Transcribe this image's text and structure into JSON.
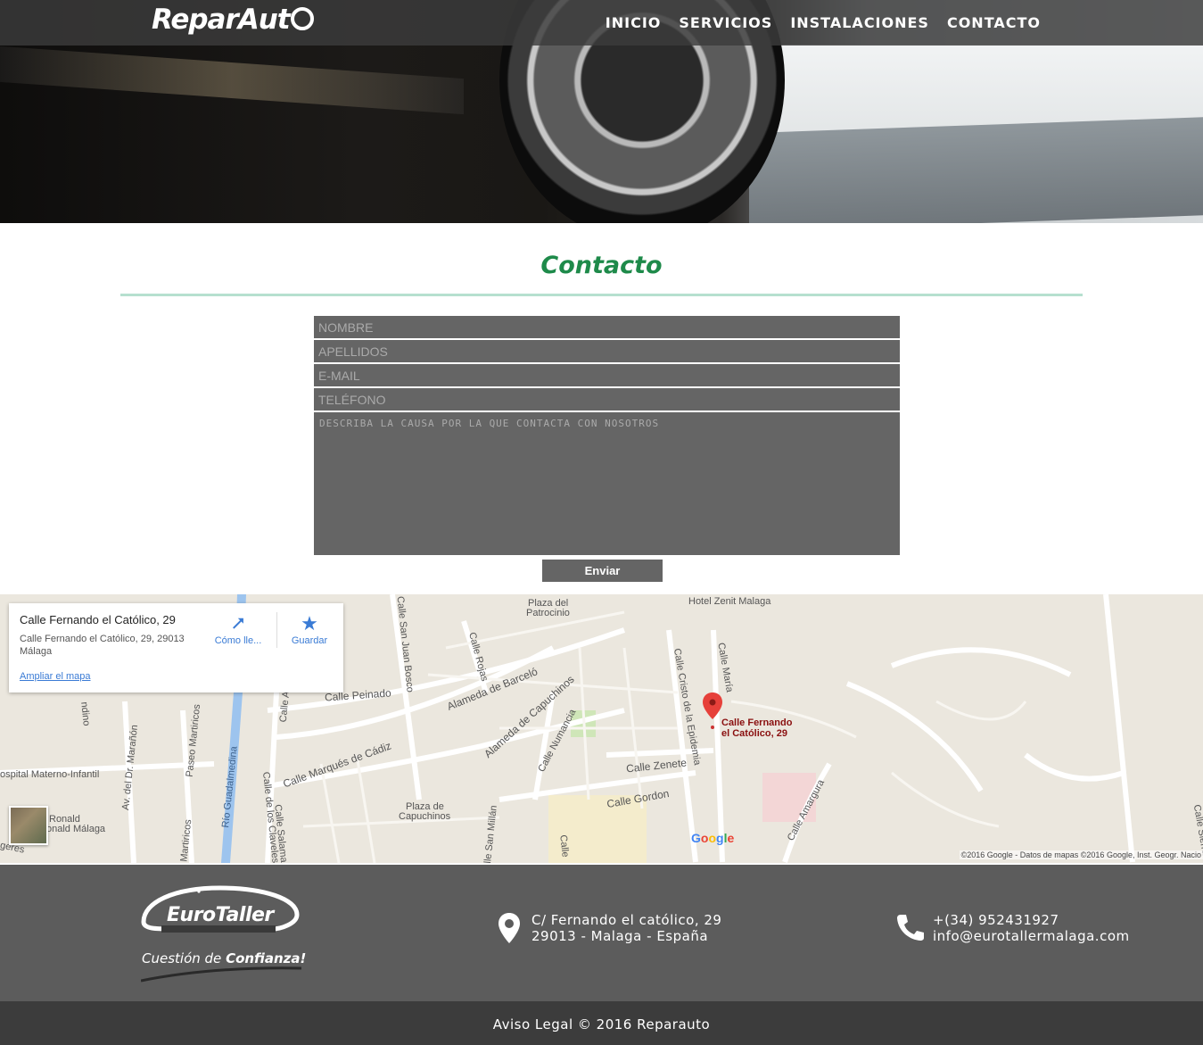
{
  "header": {
    "logo_text": "ReparAut",
    "nav": [
      "INICIO",
      "SERVICIOS",
      "INSTALACIONES",
      "CONTACTO"
    ]
  },
  "contact": {
    "title": "Contacto",
    "fields": {
      "nombre": "NOMBRE",
      "apellidos": "APELLIDOS",
      "email": "E-MAIL",
      "telefono": "TELÉFONO",
      "mensaje": "DESCRIBA LA CAUSA POR LA QUE CONTACTA CON NOSOTROS"
    },
    "submit_label": "Enviar"
  },
  "map": {
    "info_title": "Calle Fernando el Católico, 29",
    "info_address": "Calle Fernando el Católico, 29, 29013 Málaga",
    "enlarge_link": "Ampliar el mapa",
    "directions_label": "Cómo lle...",
    "save_label": "Guardar",
    "pin_label_line1": "Calle Fernando",
    "pin_label_line2": "el Católico, 29",
    "google_logo": "Google",
    "copyright": "©2016 Google - Datos de mapas ©2016 Google, Inst. Geogr. Nacio",
    "labels": {
      "l1": "Plaza del",
      "l2": "Patrocinio",
      "l3": "Hotel Zenit Malaga",
      "l4": "Calle San Juan Bosco",
      "l5": "Calle Rojas",
      "l6": "Alameda de Barceló",
      "l7": "Alameda de Capuchinos",
      "l8": "Calle Peinado",
      "l9": "Calle Cristo de la Epidemia",
      "l10": "Calle María",
      "l11": "Calle Zenete",
      "l12": "Calle Gordon",
      "l13": "Calle Numancia",
      "l14": "Calle Marqués de Cádiz",
      "l15": "Plaza de",
      "l16": "Capuchinos",
      "l17": "Río Guadalmedina",
      "l18": "Calle de los Claveles",
      "l19": "Calle Salama",
      "l20": "Paseo Martiricos",
      "l21": "Av. del Dr. Marañón",
      "l22": "ospital Materno-Infantil",
      "l23": "Ronald",
      "l24": "onald Málaga",
      "l25": "Calle Amargura",
      "l26": "Calle San Millán",
      "l27": "Martiricos",
      "l28": "Calle A",
      "l29": "ndino",
      "l30": "Calle Sierra",
      "l31": "geres",
      "l32": "Calle"
    }
  },
  "footer": {
    "brand": "EuroTaller",
    "tagline_prefix": "Cuestión de",
    "tagline_bold": "Confianza!",
    "address_line1": "C/ Fernando el católico, 29",
    "address_line2": "29013 - Malaga - España",
    "phone": "+(34) 952431927",
    "email": "info@eurotallermalaga.com",
    "legal": "Aviso Legal © 2016 Reparauto"
  },
  "colors": {
    "title_green": "#1e8a4a",
    "rule_mint": "#b6e0cf",
    "field_gray": "#656565",
    "footer_gray": "#5c5c5c",
    "bottom_bar": "#3c3c3c"
  }
}
